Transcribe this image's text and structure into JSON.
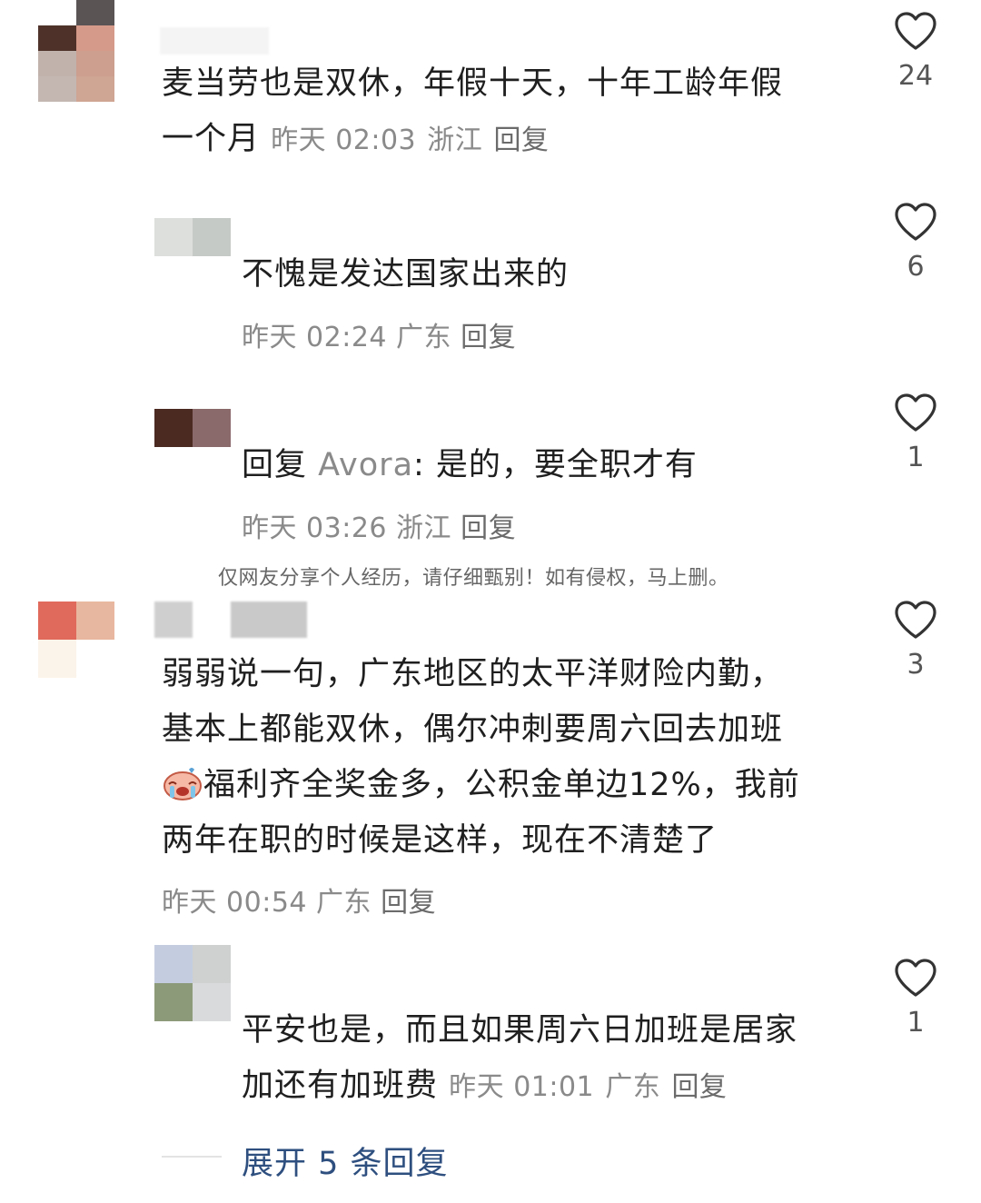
{
  "comments": [
    {
      "text": "麦当劳也是双休，年假十天，十年工龄年假一个月",
      "line1": "麦当劳也是双休，年假十天，十年工龄年假",
      "line2": "一个月",
      "time": "昨天 02:03",
      "location": "浙江",
      "reply_label": "回复",
      "likes": "24"
    },
    {
      "text": "不愧是发达国家出来的",
      "time": "昨天 02:24",
      "location": "广东",
      "reply_label": "回复",
      "likes": "6"
    },
    {
      "reply_prefix": "回复",
      "mention": "Avora",
      "text": ": 是的，要全职才有",
      "time": "昨天 03:26",
      "location": "浙江",
      "reply_label": "回复",
      "likes": "1"
    },
    {
      "line1": "弱弱说一句，广东地区的太平洋财险内勤，",
      "line2": "基本上都能双休，偶尔冲刺要周六回去加班",
      "line3": "福利齐全奖金多，公积金单边12%，我前",
      "line4": "两年在职的时候是这样，现在不清楚了",
      "time": "昨天 00:54",
      "location": "广东",
      "reply_label": "回复",
      "likes": "3"
    },
    {
      "line1": "平安也是，而且如果周六日加班是居家",
      "line2": "加还有加班费",
      "time": "昨天 01:01",
      "location": "广东",
      "reply_label": "回复",
      "likes": "1"
    }
  ],
  "watermark": "仅网友分享个人经历，请仔细甄别！如有侵权，马上删。",
  "expand_label": "展开 5 条回复",
  "colors": {
    "link": "#2e4f7f",
    "meta": "#8a8a8a",
    "text": "#1f1f1f"
  }
}
